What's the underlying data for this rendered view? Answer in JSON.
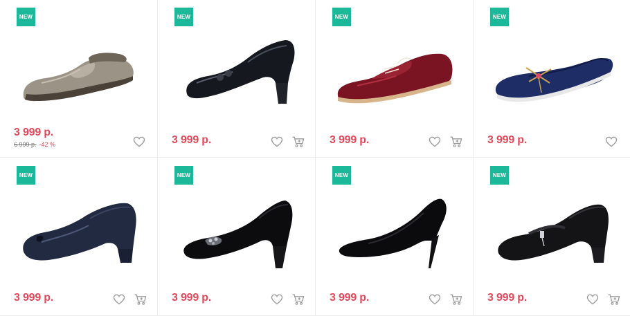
{
  "products": [
    {
      "badge": "NEW",
      "price": "3 999 р.",
      "old_price": "6 999 р.",
      "discount": "-42 %",
      "image": "gray-metallic-loafer",
      "cart": false
    },
    {
      "badge": "NEW",
      "price": "3 999 р.",
      "image": "black-patent-heeled-loafer",
      "cart": true
    },
    {
      "badge": "NEW",
      "price": "3 999 р.",
      "image": "burgundy-patent-oxford",
      "cart": true
    },
    {
      "badge": "NEW",
      "price": "3 999 р.",
      "image": "navy-suede-flat-dragonfly",
      "cart": false
    },
    {
      "badge": "NEW",
      "price": "3 999 р.",
      "image": "navy-patent-pump-bow",
      "cart": true
    },
    {
      "badge": "NEW",
      "price": "3 999 р.",
      "image": "black-suede-pump-brooch",
      "cart": true
    },
    {
      "badge": "NEW",
      "price": "3 999 р.",
      "image": "black-suede-stiletto",
      "cart": true
    },
    {
      "badge": "NEW",
      "price": "3 999 р.",
      "image": "black-leather-mary-jane-pump",
      "cart": true
    }
  ],
  "colors": {
    "badge": "#1bb99a",
    "price": "#e2485a",
    "icon": "#9a9a9a"
  }
}
